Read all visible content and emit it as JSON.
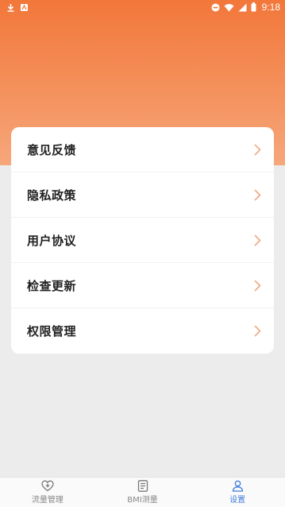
{
  "status_bar": {
    "time": "9:18",
    "left_icons": [
      "download-icon",
      "app-notification-icon"
    ],
    "right_icons": [
      "dnd-icon",
      "wifi-icon",
      "signal-icon",
      "battery-icon"
    ]
  },
  "menu": {
    "items": [
      {
        "label": "意见反馈",
        "icon": "chevron-right-icon"
      },
      {
        "label": "隐私政策",
        "icon": "chevron-right-icon"
      },
      {
        "label": "用户协议",
        "icon": "chevron-right-icon"
      },
      {
        "label": "检查更新",
        "icon": "chevron-right-icon"
      },
      {
        "label": "权限管理",
        "icon": "chevron-right-icon"
      }
    ]
  },
  "tab_bar": {
    "tabs": [
      {
        "label": "流量管理",
        "icon": "heart-plus-icon",
        "active": false
      },
      {
        "label": "BMI测量",
        "icon": "document-icon",
        "active": false
      },
      {
        "label": "设置",
        "icon": "user-icon",
        "active": true
      }
    ]
  },
  "colors": {
    "header_top": "#f2773a",
    "header_bottom": "#f6a77c",
    "active_tab": "#3f7be0",
    "inactive_tab": "#888888",
    "chevron": "#f0a883"
  }
}
